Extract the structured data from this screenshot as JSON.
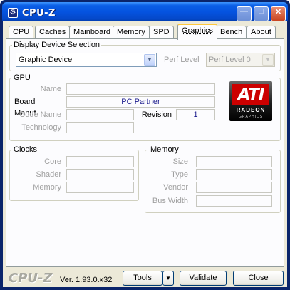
{
  "window": {
    "title": "CPU-Z",
    "icon": "cpu-z-app-icon",
    "controls": [
      "minimize-icon",
      "maximize-icon",
      "close-icon"
    ]
  },
  "tabs": [
    "CPU",
    "Caches",
    "Mainboard",
    "Memory",
    "SPD",
    "Graphics",
    "Bench",
    "About"
  ],
  "active_tab": "Graphics",
  "display": {
    "legend": "Display Device Selection",
    "device": "Graphic Device",
    "perf_label": "Perf Level",
    "perf_value": "Perf Level 0"
  },
  "gpu": {
    "legend": "GPU",
    "name_label": "Name",
    "name_value": "",
    "board_label": "Board Manuf.",
    "board_value": "PC Partner",
    "code_label": "Code Name",
    "code_value": "",
    "revision_label": "Revision",
    "revision_value": "1",
    "tech_label": "Technology",
    "tech_value": "",
    "logo": {
      "brand": "ATI",
      "sub": "RADEON",
      "caption": "GRAPHICS",
      "color": "#cc0000"
    }
  },
  "clocks": {
    "legend": "Clocks",
    "core_label": "Core",
    "shader_label": "Shader",
    "memory_label": "Memory"
  },
  "memory": {
    "legend": "Memory",
    "size_label": "Size",
    "type_label": "Type",
    "vendor_label": "Vendor",
    "bus_label": "Bus Width"
  },
  "footer": {
    "brand": "CPU-Z",
    "version": "Ver. 1.93.0.x32",
    "tools": "Tools",
    "validate": "Validate",
    "close": "Close"
  },
  "colors": {
    "titlebar": "#0553e0",
    "active_tab_highlight": "#ffc83c",
    "panel_bg": "#fcfcfe",
    "client_bg": "#ece9d8"
  }
}
